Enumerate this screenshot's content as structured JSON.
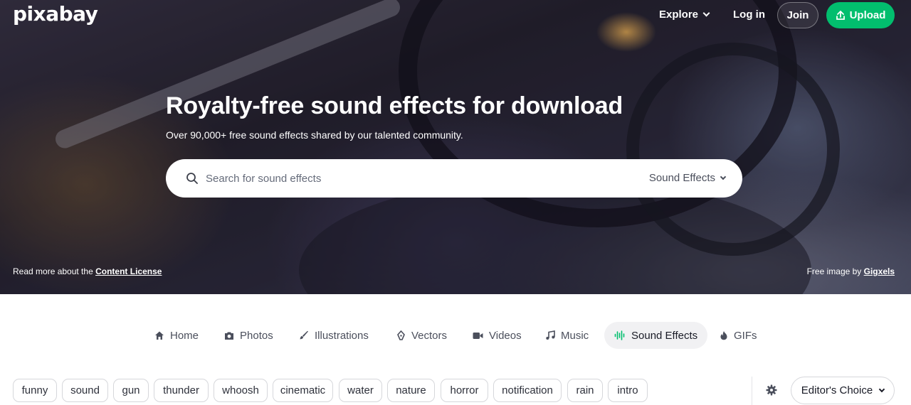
{
  "header": {
    "logo": "pixabay",
    "explore_label": "Explore",
    "login_label": "Log in",
    "join_label": "Join",
    "upload_label": "Upload"
  },
  "hero": {
    "title": "Royalty-free sound effects for download",
    "subtitle": "Over 90,000+ free sound effects shared by our talented community.",
    "license_prefix": "Read more about the ",
    "license_link": "Content License",
    "credit_prefix": "Free image by ",
    "credit_link": "Gigxels"
  },
  "search": {
    "placeholder": "Search for sound effects",
    "value": "",
    "type_label": "Sound Effects"
  },
  "categories": [
    {
      "label": "Home",
      "icon": "home-icon"
    },
    {
      "label": "Photos",
      "icon": "camera-icon"
    },
    {
      "label": "Illustrations",
      "icon": "brush-icon"
    },
    {
      "label": "Vectors",
      "icon": "pen-nib-icon"
    },
    {
      "label": "Videos",
      "icon": "video-camera-icon"
    },
    {
      "label": "Music",
      "icon": "music-note-icon"
    },
    {
      "label": "Sound Effects",
      "icon": "sound-wave-icon",
      "active": true
    },
    {
      "label": "GIFs",
      "icon": "flame-icon"
    }
  ],
  "tags": [
    "funny",
    "sound",
    "gun",
    "thunder",
    "whoosh",
    "cinematic",
    "water",
    "nature",
    "horror",
    "notification",
    "rain",
    "intro"
  ],
  "sort": {
    "label": "Editor's Choice"
  },
  "colors": {
    "brand_green": "#02be6e",
    "active_tab_bg": "#f1f1f3",
    "sound_wave_accent": "#02be6e"
  }
}
